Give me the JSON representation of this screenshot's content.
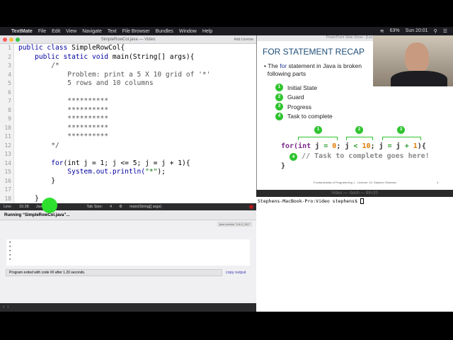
{
  "menubar": {
    "app": "TextMate",
    "items": [
      "File",
      "Edit",
      "View",
      "Navigate",
      "Text",
      "File Browser",
      "Bundles",
      "Window",
      "Help"
    ],
    "battery": "63%",
    "clock": "Sun 20:01"
  },
  "editor_window": {
    "title": "SimpleRowCol.java — Video",
    "add_license": "Add License",
    "line_numbers": [
      "1",
      "2",
      "3",
      "4",
      "5",
      "6",
      "7",
      "8",
      "9",
      "10",
      "11",
      "12",
      "13",
      "14",
      "15",
      "16",
      "17",
      "18"
    ],
    "status": {
      "line_label": "Line:",
      "line_value": "15:28",
      "language": "Java",
      "tab_size_label": "Tab Size:",
      "tab_size": "4",
      "symbol": "main(String[] args)"
    }
  },
  "code": {
    "l1a": "public class",
    "l1b": " SimpleRowCol{",
    "l2a": "    public static void",
    "l2b": " main(String[] args){",
    "l3": "        /*",
    "l4": "            Problem: print a 5 X 10 grid of '*'",
    "l5": "            5 rows and 10 columns",
    "l7": "            **********",
    "l12": "        */",
    "l14a": "        for",
    "l14b": "(int j = 1; j <= 5; j = j + 1){",
    "l15a": "            System.out.println(",
    "l15b": "\"*\"",
    "l15c": ");",
    "l16": "        }",
    "l18": "    }"
  },
  "output": {
    "running": "Running “SimpleRowCol.java”...",
    "java_version": "java version \"1.8.0_151\"",
    "lines": [
      "*",
      "*",
      "*",
      "*",
      "*"
    ],
    "exit_message": "Program exited with code #0 after 1.20 seconds.",
    "copy_output": "copy output"
  },
  "slide": {
    "window_title": "PowerPoint Slide Show - [Lecture7 ...",
    "title": "FOR STATEMENT RECAP",
    "bullet_pre": "The ",
    "bullet_kw": "for",
    "bullet_post": " statement in Java is broken",
    "bullet_line2": "following parts",
    "parts": [
      {
        "n": "1",
        "label": "Initial State"
      },
      {
        "n": "2",
        "label": "Guard"
      },
      {
        "n": "3",
        "label": "Progress"
      },
      {
        "n": "4",
        "label": "Task to complete"
      }
    ],
    "code_comment": "// Task to complete goes here!",
    "footer": "Fundamentals of Programming 1 - Lecturer: Dr. Stephen Sheridan",
    "page": "4"
  },
  "terminal": {
    "title": "Video — -bash — 88×20",
    "prompt": "Stephens-MacBook-Pro:Video stephens$ "
  }
}
